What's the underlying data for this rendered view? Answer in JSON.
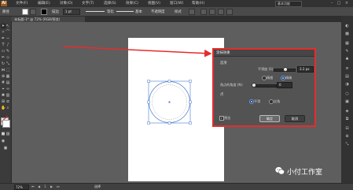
{
  "app": {
    "logo": "Ai"
  },
  "menubar": {
    "items": [
      "文件(F)",
      "编辑(E)",
      "对象(O)",
      "文字(T)",
      "选择(S)",
      "效果(C)",
      "视图(V)",
      "窗口(W)",
      "帮助(H)"
    ],
    "workspace": "基本功能"
  },
  "controlbar": {
    "selection": "路径",
    "stroke_label": "描边",
    "stroke_weight": "1 pt",
    "stroke_profile": "等比",
    "brush": "基本",
    "opacity_label": "不透明度",
    "style_label": "样式"
  },
  "tab": {
    "title": "未标题-1* @ 72% (RGB/预览)"
  },
  "statusbar": {
    "zoom": "72%",
    "page": "1",
    "mode": "选择"
  },
  "dialog": {
    "title": "涂抹效果",
    "section_options": "选项",
    "row_smooth": "平滑度 (S):",
    "row_smooth_value": "3.2 px",
    "radio_precise": "精细",
    "radio_precise2": "精确",
    "row_anchor": "角点的角度 (N):",
    "row_anchor_value": "0",
    "section_mode": "点",
    "radio_smooth_points": "平滑",
    "radio_corner_points": "尖角",
    "preview_label": "预览",
    "ok_label": "确定",
    "cancel_label": "取消"
  },
  "watermark": {
    "text": "小付工作室"
  },
  "colors": {
    "accent_red": "#e52d2d",
    "selection_blue": "#4a7bd1"
  }
}
